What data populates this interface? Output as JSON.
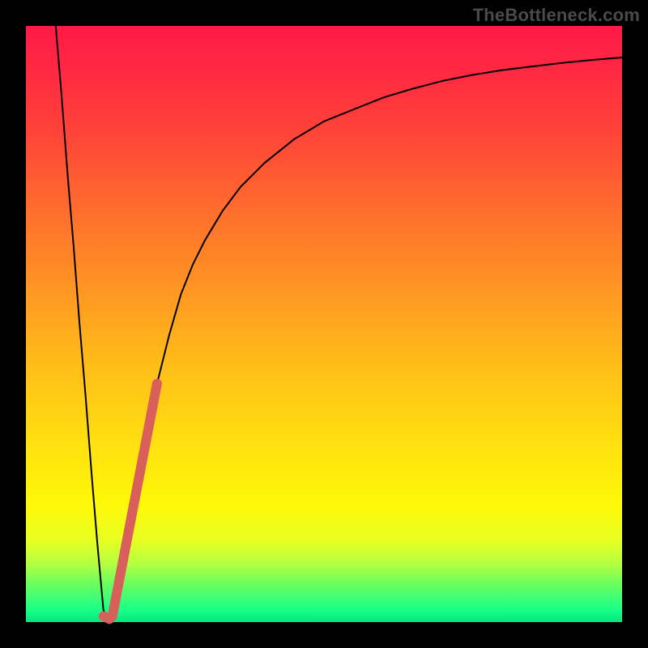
{
  "watermark": "TheBottleneck.com",
  "chart_data": {
    "type": "line",
    "title": "",
    "xlabel": "",
    "ylabel": "",
    "xlim": [
      0,
      100
    ],
    "ylim": [
      0,
      100
    ],
    "grid": false,
    "legend": false,
    "annotations": [],
    "series": [
      {
        "name": "bottleneck-curve",
        "stroke": "#000000",
        "stroke_width": 2,
        "x": [
          5,
          6,
          7,
          8,
          9,
          10,
          11,
          12,
          13,
          14,
          15,
          16,
          17,
          18,
          19,
          20,
          22,
          24,
          26,
          28,
          30,
          33,
          36,
          40,
          45,
          50,
          55,
          60,
          65,
          70,
          75,
          80,
          85,
          90,
          95,
          100
        ],
        "values": [
          100,
          88,
          75,
          63,
          50,
          38,
          25,
          13,
          2,
          0,
          2,
          6,
          12,
          19,
          25,
          30,
          40,
          48,
          55,
          60,
          64,
          69,
          73,
          77,
          81,
          84,
          86,
          88,
          89.5,
          90.8,
          91.8,
          92.6,
          93.2,
          93.8,
          94.3,
          94.7
        ]
      },
      {
        "name": "highlight-segment",
        "stroke": "#d9605a",
        "stroke_width": 12,
        "x": [
          14.5,
          22
        ],
        "values": [
          1,
          40
        ]
      },
      {
        "name": "highlight-dot",
        "stroke": "#d9605a",
        "stroke_width": 12,
        "x": [
          13,
          14
        ],
        "values": [
          1,
          0.5
        ]
      }
    ]
  }
}
